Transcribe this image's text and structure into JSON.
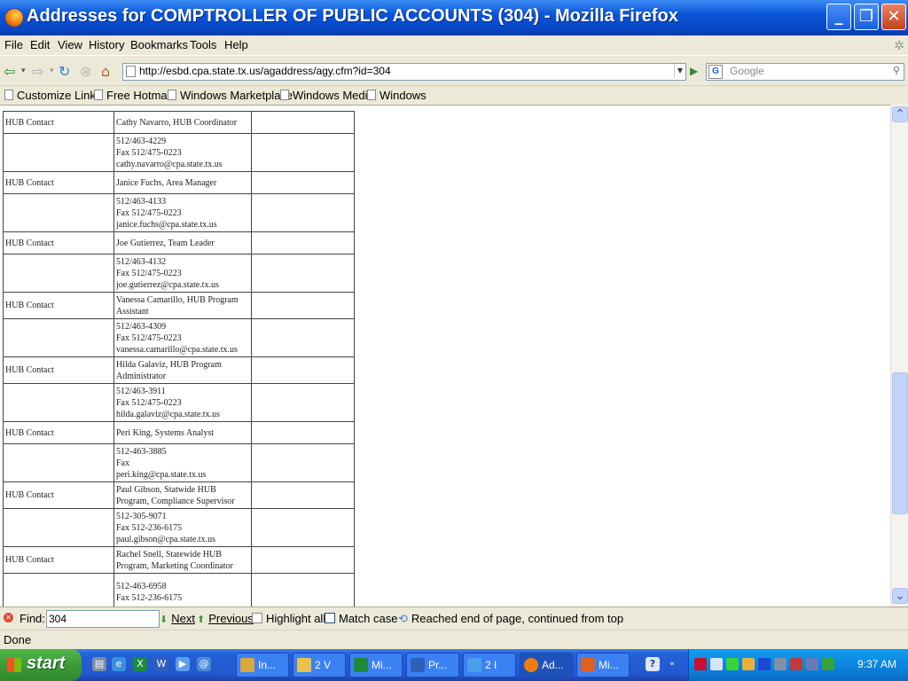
{
  "window": {
    "title": "Addresses for COMPTROLLER OF PUBLIC ACCOUNTS (304) - Mozilla Firefox"
  },
  "menu": [
    "File",
    "Edit",
    "View",
    "History",
    "Bookmarks",
    "Tools",
    "Help"
  ],
  "nav": {
    "url": "http://esbd.cpa.state.tx.us/agaddress/agy.cfm?id=304",
    "search_placeholder": "Google"
  },
  "bookmarks": [
    "Customize Links",
    "Free Hotmail",
    "Windows Marketplace",
    "Windows Media",
    "Windows"
  ],
  "contacts": [
    {
      "type": "HUB Contact",
      "name": "Cathy Navarro, HUB Coordinator",
      "phone": "512/463-4229",
      "fax": "Fax 512/475-0223",
      "email": "cathy.navarro@cpa.state.tx.us"
    },
    {
      "type": "HUB Contact",
      "name": "Janice Fuchs, Area Manager",
      "phone": "512/463-4133",
      "fax": "Fax 512/475-0223",
      "email": "janice.fuchs@cpa.state.tx.us"
    },
    {
      "type": "HUB Contact",
      "name": "Joe Gutierrez, Team Leader",
      "phone": "512/463-4132",
      "fax": "Fax 512/475-0223",
      "email": "joe.gutierrez@cpa.state.tx.us"
    },
    {
      "type": "HUB Contact",
      "name": "Vanessa Camarillo, HUB Program Assistant",
      "phone": "512/463-4309",
      "fax": "Fax 512/475-0223",
      "email": "vanessa.camarillo@cpa.state.tx.us"
    },
    {
      "type": "HUB Contact",
      "name": "Hilda Galaviz, HUB Program Administrator",
      "phone": "512/463-3911",
      "fax": "Fax 512/475-0223",
      "email": "hilda.galaviz@cpa.state.tx.us"
    },
    {
      "type": "HUB Contact",
      "name": "Peri King, Systems Analyst",
      "phone": "512-463-3885",
      "fax": "Fax",
      "email": "peri.king@cpa.state.tx.us"
    },
    {
      "type": "HUB Contact",
      "name": "Paul Gibson, Statwide HUB Program, Compliance Supervisor",
      "phone": "512-305-9071",
      "fax": "Fax 512-236-6175",
      "email": "paul.gibson@cpa.state.tx.us"
    },
    {
      "type": "HUB Contact",
      "name": "Rachel Snell, Statewide HUB Program, Marketing Coordinator",
      "phone": "512-463-6958",
      "fax": "Fax 512-236-6175",
      "email": ""
    }
  ],
  "find": {
    "label": "Find:",
    "value": "304",
    "next": "Next",
    "previous": "Previous",
    "highlight": "Highlight all",
    "match_case": "Match case",
    "status": "Reached end of page, continued from top"
  },
  "status": {
    "text": "Done"
  },
  "taskbar": {
    "start": "start",
    "tasks": [
      {
        "label": "In...",
        "color": "#d9a73a"
      },
      {
        "label": "2 V",
        "color": "#e8c24a"
      },
      {
        "label": "Mi...",
        "color": "#1d8a3a"
      },
      {
        "label": "Pr...",
        "color": "#2f5fb8"
      },
      {
        "label": "2 I",
        "color": "#4aa0e8"
      },
      {
        "label": "Ad...",
        "color": "#f07b0f"
      },
      {
        "label": "Mi...",
        "color": "#e06020"
      }
    ],
    "clock": "9:37 AM"
  },
  "colors": {
    "titlebar": "#0a55d8",
    "chrome": "#ece9d8",
    "taskbar": "#2460d6",
    "tray": "#0c86e0"
  }
}
